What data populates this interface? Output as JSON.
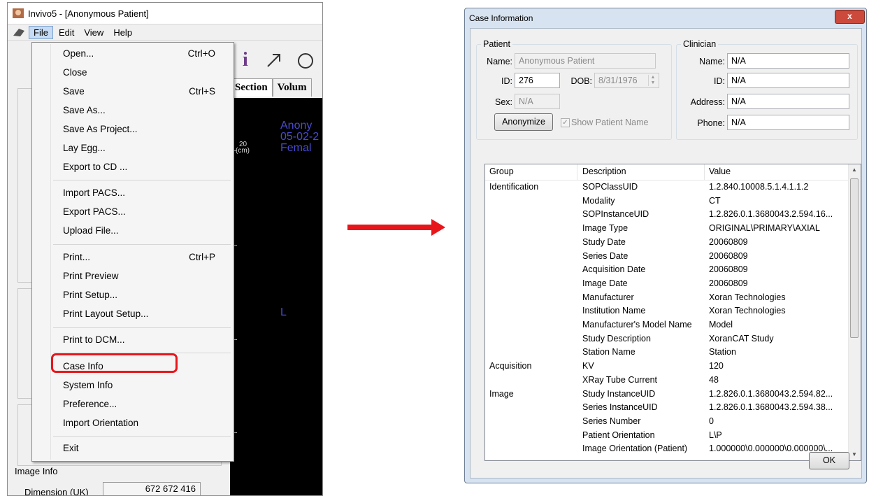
{
  "app": {
    "title": "Invivo5 - [Anonymous Patient]",
    "menubar": [
      "File",
      "Edit",
      "View",
      "Help"
    ],
    "tabs": [
      "Section",
      "Volum"
    ],
    "viewport": {
      "overlay_lines": [
        "Anony",
        "05-02-2",
        "Femal"
      ],
      "scale_value": "20",
      "scale_unit": "(cm)",
      "orientation_marker": "L"
    },
    "image_info": {
      "label": "Image Info",
      "dimension_label": "Dimension (UK)",
      "dimension_value": "672  672  416"
    }
  },
  "file_menu": {
    "items": [
      {
        "label": "Open...",
        "shortcut": "Ctrl+O"
      },
      {
        "label": "Close",
        "shortcut": ""
      },
      {
        "label": "Save",
        "shortcut": "Ctrl+S"
      },
      {
        "label": "Save As...",
        "shortcut": ""
      },
      {
        "label": "Save As Project...",
        "shortcut": ""
      },
      {
        "label": "Lay Egg...",
        "shortcut": ""
      },
      {
        "label": "Export to CD ...",
        "shortcut": ""
      },
      {
        "label": "Import PACS...",
        "shortcut": ""
      },
      {
        "label": "Export PACS...",
        "shortcut": ""
      },
      {
        "label": "Upload File...",
        "shortcut": ""
      },
      {
        "label": "Print...",
        "shortcut": "Ctrl+P"
      },
      {
        "label": "Print Preview",
        "shortcut": ""
      },
      {
        "label": "Print Setup...",
        "shortcut": ""
      },
      {
        "label": "Print Layout Setup...",
        "shortcut": ""
      },
      {
        "label": "Print to DCM...",
        "shortcut": ""
      },
      {
        "label": "Case Info",
        "shortcut": ""
      },
      {
        "label": "System Info",
        "shortcut": ""
      },
      {
        "label": "Preference...",
        "shortcut": ""
      },
      {
        "label": "Import Orientation",
        "shortcut": ""
      },
      {
        "label": "Exit",
        "shortcut": ""
      }
    ],
    "highlighted": "Case Info",
    "highlight_color": "#e8161b"
  },
  "dialog": {
    "title": "Case Information",
    "close_label": "x",
    "patient": {
      "legend": "Patient",
      "name_label": "Name:",
      "name_value": "Anonymous Patient",
      "id_label": "ID:",
      "id_value": "276",
      "dob_label": "DOB:",
      "dob_value": "8/31/1976",
      "sex_label": "Sex:",
      "sex_value": "N/A",
      "anonymize_label": "Anonymize",
      "show_name_label": "Show Patient Name",
      "show_name_checked": true
    },
    "clinician": {
      "legend": "Clinician",
      "name_label": "Name:",
      "name_value": "N/A",
      "id_label": "ID:",
      "id_value": "N/A",
      "address_label": "Address:",
      "address_value": "N/A",
      "phone_label": "Phone:",
      "phone_value": "N/A"
    },
    "table": {
      "columns": [
        "Group",
        "Description",
        "Value"
      ],
      "rows": [
        {
          "group": "Identification",
          "description": "SOPClassUID",
          "value": "1.2.840.10008.5.1.4.1.1.2"
        },
        {
          "group": "",
          "description": "Modality",
          "value": "CT"
        },
        {
          "group": "",
          "description": "SOPInstanceUID",
          "value": "1.2.826.0.1.3680043.2.594.16..."
        },
        {
          "group": "",
          "description": "Image Type",
          "value": "ORIGINAL\\PRIMARY\\AXIAL"
        },
        {
          "group": "",
          "description": "Study Date",
          "value": "20060809"
        },
        {
          "group": "",
          "description": "Series Date",
          "value": "20060809"
        },
        {
          "group": "",
          "description": "Acquisition Date",
          "value": "20060809"
        },
        {
          "group": "",
          "description": "Image Date",
          "value": "20060809"
        },
        {
          "group": "",
          "description": "Manufacturer",
          "value": "Xoran Technologies"
        },
        {
          "group": "",
          "description": "Institution Name",
          "value": "Xoran Technologies"
        },
        {
          "group": "",
          "description": "Manufacturer's Model Name",
          "value": "Model"
        },
        {
          "group": "",
          "description": "Study Description",
          "value": "XoranCAT Study"
        },
        {
          "group": "",
          "description": "Station Name",
          "value": "Station"
        },
        {
          "group": "Acquisition",
          "description": "KV",
          "value": "120"
        },
        {
          "group": "",
          "description": "XRay Tube Current",
          "value": "48"
        },
        {
          "group": "Image",
          "description": "Study InstanceUID",
          "value": "1.2.826.0.1.3680043.2.594.82..."
        },
        {
          "group": "",
          "description": "Series InstanceUID",
          "value": "1.2.826.0.1.3680043.2.594.38..."
        },
        {
          "group": "",
          "description": "Series Number",
          "value": "0"
        },
        {
          "group": "",
          "description": "Patient Orientation",
          "value": "L\\P"
        },
        {
          "group": "",
          "description": "Image Orientation (Patient)",
          "value": "1.000000\\0.000000\\0.000000\\..."
        }
      ]
    },
    "ok_label": "OK"
  },
  "colors": {
    "arrow": "#e8161b",
    "viewport_text": "#4a4ad0",
    "info_icon": "#6f3c8a"
  }
}
